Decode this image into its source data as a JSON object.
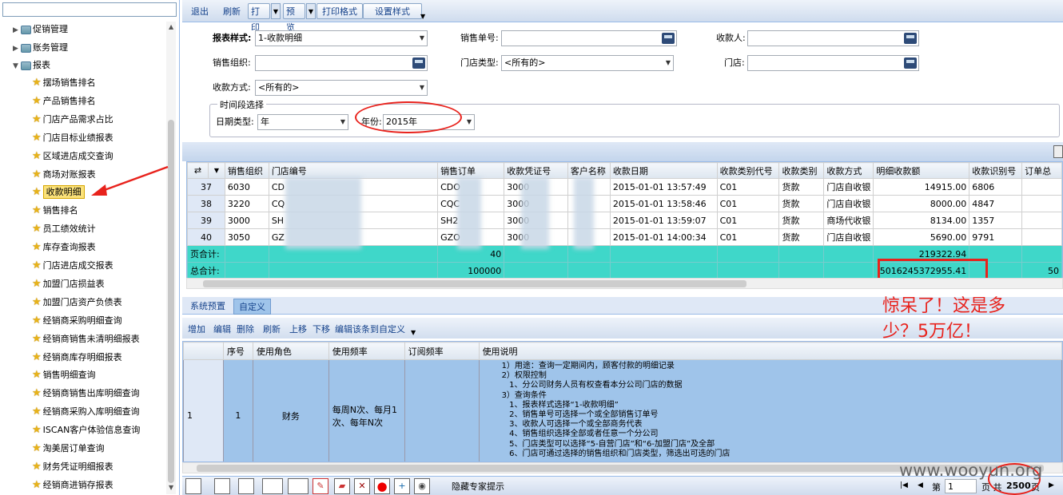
{
  "left_tree": {
    "search_value": "",
    "groups": [
      {
        "label": "促销管理"
      },
      {
        "label": "账务管理"
      },
      {
        "label": "报表"
      }
    ],
    "items": [
      "摆场销售排名",
      "产品销售排名",
      "门店产品需求占比",
      "门店目标业绩报表",
      "区域进店成交查询",
      "商场对账报表",
      "收款明细",
      "销售排名",
      "员工绩效统计",
      "库存查询报表",
      "门店进店成交报表",
      "加盟门店损益表",
      "加盟门店资产负债表",
      "经销商采购明细查询",
      "经销商销售未清明细报表",
      "经销商库存明细报表",
      "销售明细查询",
      "经销商销售出库明细查询",
      "经销商采购入库明细查询",
      "ISCAN客户体验信息查询",
      "淘美居订单查询",
      "财务凭证明细报表",
      "经销商进销存报表"
    ],
    "selected": "收款明细"
  },
  "toolbar": {
    "exit": "退出",
    "refresh": "刷新",
    "print": "打印",
    "preview": "预览",
    "print_format": "打印格式",
    "set_style": "设置样式"
  },
  "form": {
    "report_style_label": "报表样式:",
    "report_style_value": "1-收款明细",
    "sales_no_label": "销售单号:",
    "sales_no_value": "",
    "payee_label": "收款人:",
    "payee_value": "",
    "sales_org_label": "销售组织:",
    "sales_org_value": "",
    "store_type_label": "门店类型:",
    "store_type_value": "<所有的>",
    "store_label": "门店:",
    "store_value": "",
    "pay_method_label": "收款方式:",
    "pay_method_value": "<所有的>",
    "period_legend": "时间段选择",
    "date_type_label": "日期类型:",
    "date_type_value": "年",
    "year_label": "年份:",
    "year_value": "2015年"
  },
  "grid": {
    "columns": [
      "销售组织",
      "门店编号",
      "销售订单",
      "收款凭证号",
      "客户名称",
      "收款日期",
      "收款类别代号",
      "收款类别",
      "收款方式",
      "明细收款额",
      "收款识别号",
      "订单总"
    ],
    "rows": [
      {
        "rn": "37",
        "org": "6030",
        "store": "CD",
        "store2": "旗舰店",
        "order": "CDO",
        "order2": "98",
        "voucher": "3000",
        "voucher2": "56",
        "cust": "",
        "date": "2015-01-01 13:57:49",
        "code": "C01",
        "cat": "货款",
        "method": "门店自收银",
        "amount": "14915.00",
        "rid": "6806"
      },
      {
        "rn": "38",
        "org": "3220",
        "store": "CQ",
        "store2": "龙二店",
        "order": "CQC",
        "order2": "74",
        "voucher": "3000",
        "voucher2": "6",
        "cust": "",
        "date": "2015-01-01 13:58:46",
        "code": "C01",
        "cat": "货款",
        "method": "门店自收银",
        "amount": "8000.00",
        "rid": "4847"
      },
      {
        "rn": "39",
        "org": "3000",
        "store": "SH",
        "store2": "旗舰店",
        "order": "SH2",
        "order2": "00",
        "voucher": "3000",
        "voucher2": "1",
        "cust": "",
        "date": "2015-01-01 13:59:07",
        "code": "C01",
        "cat": "货款",
        "method": "商场代收银",
        "amount": "8134.00",
        "rid": "1357"
      },
      {
        "rn": "40",
        "org": "3050",
        "store": "GZ",
        "store2": "总店",
        "order": "GZO",
        "order2": "3",
        "voucher": "3000",
        "voucher2": "",
        "cust": "",
        "date": "2015-01-01 14:00:34",
        "code": "C01",
        "cat": "货款",
        "method": "门店自收银",
        "amount": "5690.00",
        "rid": "9791"
      }
    ],
    "page_total_label": "页合计:",
    "page_total_count": "40",
    "page_total_amount": "219322.94",
    "grand_total_label": "总合计:",
    "grand_total_count": "100000",
    "grand_total_amount": "5016245372955.41",
    "grand_total_tail": "50"
  },
  "bottom_tabs": {
    "preset": "系统预置",
    "custom": "自定义"
  },
  "bottom_toolbar": {
    "add": "增加",
    "edit": "编辑",
    "delete": "删除",
    "refresh": "刷新",
    "up": "上移",
    "down": "下移",
    "edit_to_custom": "编辑该条到自定义"
  },
  "usage_grid": {
    "columns": [
      "序号",
      "使用角色",
      "使用频率",
      "订阅频率",
      "使用说明"
    ],
    "row": {
      "rn": "1",
      "seq": "1",
      "role": "财务",
      "freq": "每周N次、每月1次、每年N次",
      "sub": "",
      "desc": [
        "1）用途：查询一定期间内，顾客付款的明细记录",
        "2）权限控制",
        "   1、分公司财务人员有权查看本分公司门店的数据",
        "3）查询条件",
        "   1、报表样式选择“1-收款明细”",
        "   2、销售单号可选择一个或全部销售订单号",
        "   3、收款人可选择一个或全部商务代表",
        "   4、销售组织选择全部或者任意一个分公司",
        "   5、门店类型可以选择“5-自营门店”和“6-加盟门店”及全部",
        "   6、门店可通过选择的销售组织和门店类型，筛选出可选的门店"
      ]
    }
  },
  "status": {
    "hide_tips": "隐藏专家提示",
    "page_label": "第",
    "page_value": "1",
    "of_label": "页 共",
    "total_pages": "2500",
    "total_suffix": "页"
  },
  "annotation": {
    "line1": "惊呆了！这是多",
    "line2": "少？5万亿！"
  },
  "watermark": "www.wooyun.org",
  "colors": {
    "sum_row": "#3fd7c9",
    "annotation": "#e8221c",
    "selected_row": "#9fc4ea"
  }
}
